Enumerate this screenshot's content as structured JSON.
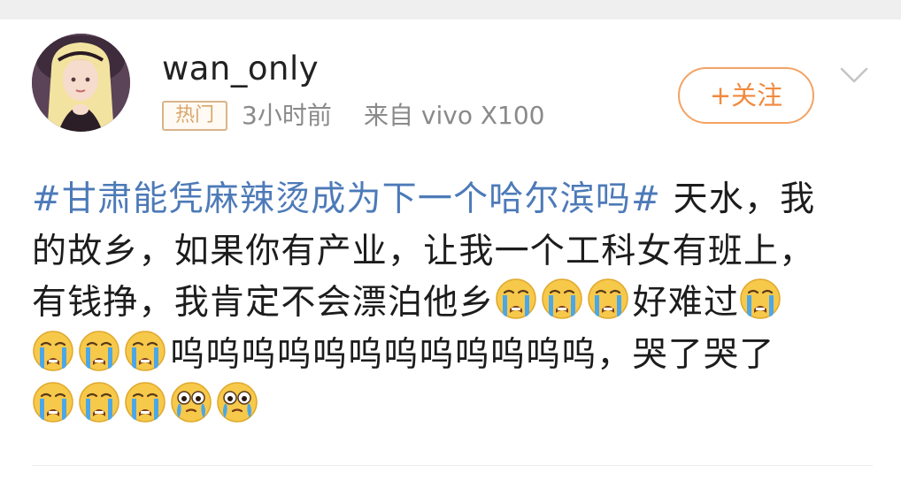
{
  "post": {
    "username": "wan_only",
    "badge": "热门",
    "time": "3小时前",
    "source": "来自 vivo X100",
    "follow_label": "+关注",
    "hashtag": "#甘肃能凭麻辣烫成为下一个哈尔滨吗#",
    "line1_rest": " 天水，我",
    "line2": "的故乡，如果你有产业，让我一个工科女有班上，",
    "line3_text": "有钱挣，我肯定不会漂泊他乡",
    "line3_tail": "好难过",
    "line4_text": "呜呜呜呜呜呜呜呜呜呜呜呜，哭了哭了"
  },
  "icons": {
    "avatar": "avatar",
    "more": "chevron-down-icon",
    "crying": "loudly-crying-face-icon",
    "teary": "teary-eyes-face-icon"
  },
  "colors": {
    "hashtag": "#4d7ab8",
    "follow": "#f08a3e",
    "badge": "#d9a56b",
    "meta": "#8a8a8a"
  }
}
